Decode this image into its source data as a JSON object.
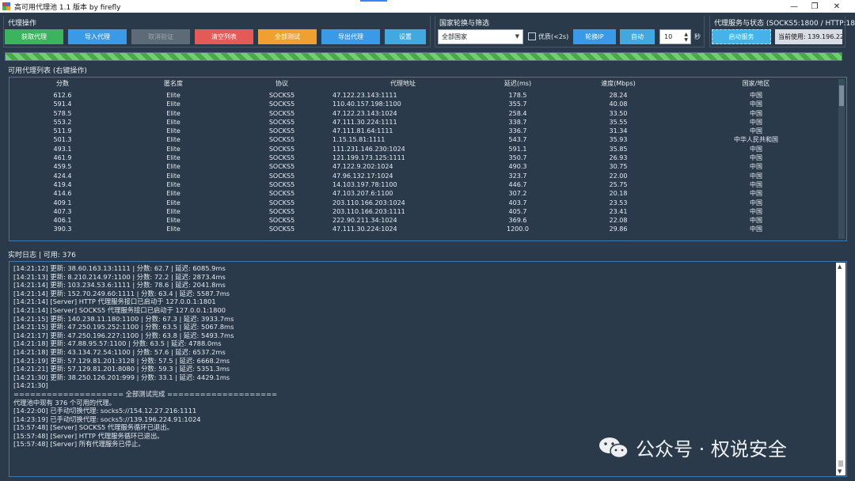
{
  "window": {
    "title": "高可用代理池 1.1 版本 by firefly",
    "min_glyph": "—",
    "max_glyph": "❐",
    "close_glyph": "✕"
  },
  "proxy_ops": {
    "title": "代理操作",
    "fetch": "获取代理",
    "import": "导入代理",
    "cancel": "取消验证",
    "clear": "清空列表",
    "test_all": "全部测试",
    "export": "导出代理",
    "settings": "设置"
  },
  "rotation": {
    "title": "国家轮换与筛选",
    "country_value": "全部国家",
    "quality_label": "优质(<2s)",
    "rotate_ip": "轮换IP",
    "auto": "自动",
    "interval_value": "10",
    "unit": "秒"
  },
  "service": {
    "title": "代理服务与状态 (SOCKS5:1800 / HTTP:180",
    "start": "启动服务",
    "current_use": "当前使用: 139.196.224.91:1024"
  },
  "progress": {
    "value": 1.0
  },
  "table": {
    "label": "可用代理列表 (右键操作)",
    "headers": [
      "分数",
      "匿名度",
      "协议",
      "代理地址",
      "延迟(ms)",
      "速度(Mbps)",
      "国家/地区"
    ],
    "rows": [
      [
        "612.6",
        "Elite",
        "SOCKS5",
        "47.122.23.143:1111",
        "178.5",
        "28.24",
        "中国"
      ],
      [
        "591.4",
        "Elite",
        "SOCKS5",
        "110.40.157.198:1100",
        "355.7",
        "40.08",
        "中国"
      ],
      [
        "578.5",
        "Elite",
        "SOCKS5",
        "47.122.23.143:1024",
        "258.4",
        "33.50",
        "中国"
      ],
      [
        "553.2",
        "Elite",
        "SOCKS5",
        "47.111.30.224:1111",
        "338.7",
        "35.55",
        "中国"
      ],
      [
        "511.9",
        "Elite",
        "SOCKS5",
        "47.111.81.64:1111",
        "336.7",
        "31.34",
        "中国"
      ],
      [
        "501.3",
        "Elite",
        "SOCKS5",
        "1.15.15.81:1111",
        "543.7",
        "35.93",
        "中华人民共和国"
      ],
      [
        "493.1",
        "Elite",
        "SOCKS5",
        "111.231.146.230:1024",
        "591.1",
        "35.85",
        "中国"
      ],
      [
        "461.9",
        "Elite",
        "SOCKS5",
        "121.199.173.125:1111",
        "350.7",
        "26.93",
        "中国"
      ],
      [
        "459.5",
        "Elite",
        "SOCKS5",
        "47.122.9.202:1024",
        "490.3",
        "30.75",
        "中国"
      ],
      [
        "424.4",
        "Elite",
        "SOCKS5",
        "47.96.132.17:1024",
        "323.7",
        "22.00",
        "中国"
      ],
      [
        "419.4",
        "Elite",
        "SOCKS5",
        "14.103.197.78:1100",
        "446.7",
        "25.75",
        "中国"
      ],
      [
        "414.6",
        "Elite",
        "SOCKS5",
        "47.103.207.6:1100",
        "307.2",
        "20.18",
        "中国"
      ],
      [
        "409.1",
        "Elite",
        "SOCKS5",
        "203.110.166.203:1024",
        "403.7",
        "23.53",
        "中国"
      ],
      [
        "407.3",
        "Elite",
        "SOCKS5",
        "203.110.166.203:1111",
        "405.7",
        "23.41",
        "中国"
      ],
      [
        "406.1",
        "Elite",
        "SOCKS5",
        "222.90.211.34:1024",
        "369.6",
        "22.08",
        "中国"
      ],
      [
        "390.3",
        "Elite",
        "SOCKS5",
        "47.111.30.224:1024",
        "1200.0",
        "29.86",
        "中国"
      ]
    ]
  },
  "log": {
    "label": "实时日志 | 可用: 376",
    "lines": [
      "[14:21:12] 更新: 38.60.163.13:1111 | 分数: 62.7 | 延迟: 6085.9ms",
      "[14:21:13] 更新: 8.210.214.97:1100 | 分数: 72.2 | 延迟: 2873.4ms",
      "[14:21:14] 更新: 103.234.53.6:1111 | 分数: 78.6 | 延迟: 2041.8ms",
      "[14:21:14] 更新: 152.70.249.60:1111 | 分数: 63.4 | 延迟: 5587.7ms",
      "[14:21:14] [Server] HTTP 代理服务接口已启动于 127.0.0.1:1801",
      "[14:21:14] [Server] SOCKS5 代理服务接口已启动于 127.0.0.1:1800",
      "[14:21:15] 更新: 140.238.11.180:1100 | 分数: 67.3 | 延迟: 3933.7ms",
      "[14:21:15] 更新: 47.250.195.252:1100 | 分数: 63.5 | 延迟: 5067.8ms",
      "[14:21:17] 更新: 47.250.196.227:1100 | 分数: 63.8 | 延迟: 5493.7ms",
      "[14:21:18] 更新: 47.88.95.57:1100 | 分数: 63.5 | 延迟: 4788.0ms",
      "[14:21:18] 更新: 43.134.72.54:1100 | 分数: 57.6 | 延迟: 6537.2ms",
      "[14:21:19] 更新: 57.129.81.201:3128 | 分数: 57.5 | 延迟: 6668.2ms",
      "[14:21:21] 更新: 57.129.81.201:8080 | 分数: 59.3 | 延迟: 5351.3ms",
      "[14:21:30] 更新: 38.250.126.201:999 | 分数: 33.1 | 延迟: 4429.1ms",
      "[14:21:30]",
      "==================== 全部测试完成 ====================",
      "代理池中现有 376 个可用的代理。",
      "[14:22:00] 已手动切换代理: socks5://154.12.27.216:1111",
      "[14:23:19] 已手动切换代理: socks5://139.196.224.91:1024",
      "[15:57:48] [Server] SOCKS5 代理服务循环已退出。",
      "[15:57:48] [Server] HTTP 代理服务循环已退出。",
      "[15:57:48] [Server] 所有代理服务已停止。"
    ]
  },
  "watermark": {
    "text": "公众号 · 权说安全"
  },
  "colors": {
    "background": "#2b3a4a",
    "green": "#3bb45d",
    "blue": "#3a9ae8",
    "red": "#e35a57",
    "orange": "#f0a030",
    "border": "#3e78b4"
  }
}
